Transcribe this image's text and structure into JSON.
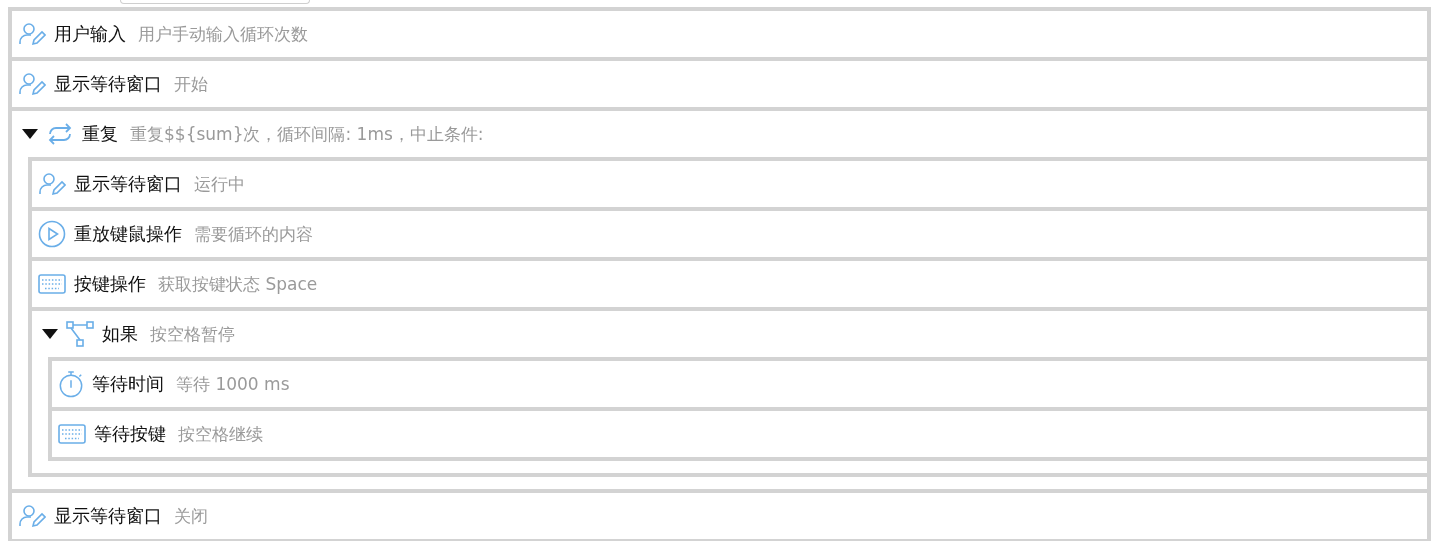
{
  "nodes": [
    {
      "kind": "input",
      "title": "用户输入",
      "detail": "用户手动输入循环次数"
    },
    {
      "kind": "window",
      "title": "显示等待窗口",
      "detail": "开始"
    },
    {
      "kind": "repeat",
      "title": "重复",
      "detail": "重复$${sum}次，循环间隔: 1ms，中止条件:",
      "expanded": true,
      "children": [
        {
          "kind": "window",
          "title": "显示等待窗口",
          "detail": "运行中"
        },
        {
          "kind": "replay",
          "title": "重放键鼠操作",
          "detail": "需要循环的内容"
        },
        {
          "kind": "key",
          "title": "按键操作",
          "detail": "获取按键状态 Space"
        },
        {
          "kind": "if",
          "title": "如果",
          "detail": "按空格暂停",
          "expanded": true,
          "children": [
            {
              "kind": "delay",
              "title": "等待时间",
              "detail": "等待 1000 ms"
            },
            {
              "kind": "waitkey",
              "title": "等待按键",
              "detail": "按空格继续"
            }
          ]
        }
      ]
    },
    {
      "kind": "window",
      "title": "显示等待窗口",
      "detail": "关闭"
    }
  ]
}
